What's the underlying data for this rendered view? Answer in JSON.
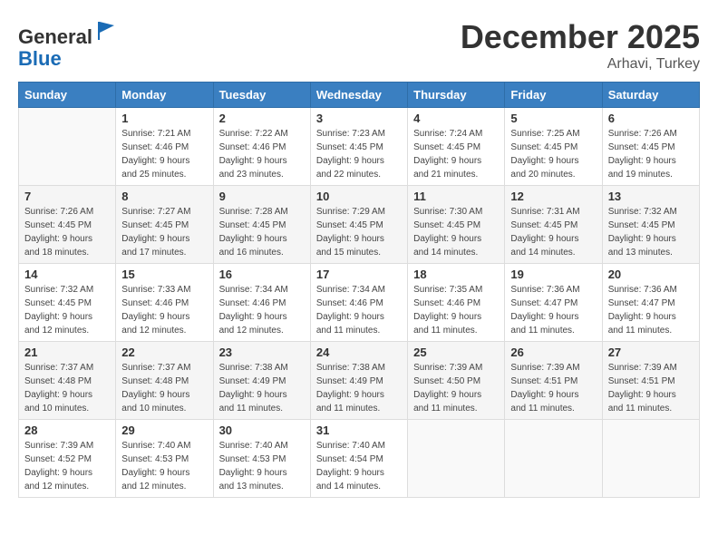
{
  "header": {
    "logo_line1": "General",
    "logo_line2": "Blue",
    "month": "December 2025",
    "location": "Arhavi, Turkey"
  },
  "weekdays": [
    "Sunday",
    "Monday",
    "Tuesday",
    "Wednesday",
    "Thursday",
    "Friday",
    "Saturday"
  ],
  "weeks": [
    [
      {
        "day": "",
        "sunrise": "",
        "sunset": "",
        "daylight": ""
      },
      {
        "day": "1",
        "sunrise": "Sunrise: 7:21 AM",
        "sunset": "Sunset: 4:46 PM",
        "daylight": "Daylight: 9 hours and 25 minutes."
      },
      {
        "day": "2",
        "sunrise": "Sunrise: 7:22 AM",
        "sunset": "Sunset: 4:46 PM",
        "daylight": "Daylight: 9 hours and 23 minutes."
      },
      {
        "day": "3",
        "sunrise": "Sunrise: 7:23 AM",
        "sunset": "Sunset: 4:45 PM",
        "daylight": "Daylight: 9 hours and 22 minutes."
      },
      {
        "day": "4",
        "sunrise": "Sunrise: 7:24 AM",
        "sunset": "Sunset: 4:45 PM",
        "daylight": "Daylight: 9 hours and 21 minutes."
      },
      {
        "day": "5",
        "sunrise": "Sunrise: 7:25 AM",
        "sunset": "Sunset: 4:45 PM",
        "daylight": "Daylight: 9 hours and 20 minutes."
      },
      {
        "day": "6",
        "sunrise": "Sunrise: 7:26 AM",
        "sunset": "Sunset: 4:45 PM",
        "daylight": "Daylight: 9 hours and 19 minutes."
      }
    ],
    [
      {
        "day": "7",
        "sunrise": "Sunrise: 7:26 AM",
        "sunset": "Sunset: 4:45 PM",
        "daylight": "Daylight: 9 hours and 18 minutes."
      },
      {
        "day": "8",
        "sunrise": "Sunrise: 7:27 AM",
        "sunset": "Sunset: 4:45 PM",
        "daylight": "Daylight: 9 hours and 17 minutes."
      },
      {
        "day": "9",
        "sunrise": "Sunrise: 7:28 AM",
        "sunset": "Sunset: 4:45 PM",
        "daylight": "Daylight: 9 hours and 16 minutes."
      },
      {
        "day": "10",
        "sunrise": "Sunrise: 7:29 AM",
        "sunset": "Sunset: 4:45 PM",
        "daylight": "Daylight: 9 hours and 15 minutes."
      },
      {
        "day": "11",
        "sunrise": "Sunrise: 7:30 AM",
        "sunset": "Sunset: 4:45 PM",
        "daylight": "Daylight: 9 hours and 14 minutes."
      },
      {
        "day": "12",
        "sunrise": "Sunrise: 7:31 AM",
        "sunset": "Sunset: 4:45 PM",
        "daylight": "Daylight: 9 hours and 14 minutes."
      },
      {
        "day": "13",
        "sunrise": "Sunrise: 7:32 AM",
        "sunset": "Sunset: 4:45 PM",
        "daylight": "Daylight: 9 hours and 13 minutes."
      }
    ],
    [
      {
        "day": "14",
        "sunrise": "Sunrise: 7:32 AM",
        "sunset": "Sunset: 4:45 PM",
        "daylight": "Daylight: 9 hours and 12 minutes."
      },
      {
        "day": "15",
        "sunrise": "Sunrise: 7:33 AM",
        "sunset": "Sunset: 4:46 PM",
        "daylight": "Daylight: 9 hours and 12 minutes."
      },
      {
        "day": "16",
        "sunrise": "Sunrise: 7:34 AM",
        "sunset": "Sunset: 4:46 PM",
        "daylight": "Daylight: 9 hours and 12 minutes."
      },
      {
        "day": "17",
        "sunrise": "Sunrise: 7:34 AM",
        "sunset": "Sunset: 4:46 PM",
        "daylight": "Daylight: 9 hours and 11 minutes."
      },
      {
        "day": "18",
        "sunrise": "Sunrise: 7:35 AM",
        "sunset": "Sunset: 4:46 PM",
        "daylight": "Daylight: 9 hours and 11 minutes."
      },
      {
        "day": "19",
        "sunrise": "Sunrise: 7:36 AM",
        "sunset": "Sunset: 4:47 PM",
        "daylight": "Daylight: 9 hours and 11 minutes."
      },
      {
        "day": "20",
        "sunrise": "Sunrise: 7:36 AM",
        "sunset": "Sunset: 4:47 PM",
        "daylight": "Daylight: 9 hours and 11 minutes."
      }
    ],
    [
      {
        "day": "21",
        "sunrise": "Sunrise: 7:37 AM",
        "sunset": "Sunset: 4:48 PM",
        "daylight": "Daylight: 9 hours and 10 minutes."
      },
      {
        "day": "22",
        "sunrise": "Sunrise: 7:37 AM",
        "sunset": "Sunset: 4:48 PM",
        "daylight": "Daylight: 9 hours and 10 minutes."
      },
      {
        "day": "23",
        "sunrise": "Sunrise: 7:38 AM",
        "sunset": "Sunset: 4:49 PM",
        "daylight": "Daylight: 9 hours and 11 minutes."
      },
      {
        "day": "24",
        "sunrise": "Sunrise: 7:38 AM",
        "sunset": "Sunset: 4:49 PM",
        "daylight": "Daylight: 9 hours and 11 minutes."
      },
      {
        "day": "25",
        "sunrise": "Sunrise: 7:39 AM",
        "sunset": "Sunset: 4:50 PM",
        "daylight": "Daylight: 9 hours and 11 minutes."
      },
      {
        "day": "26",
        "sunrise": "Sunrise: 7:39 AM",
        "sunset": "Sunset: 4:51 PM",
        "daylight": "Daylight: 9 hours and 11 minutes."
      },
      {
        "day": "27",
        "sunrise": "Sunrise: 7:39 AM",
        "sunset": "Sunset: 4:51 PM",
        "daylight": "Daylight: 9 hours and 11 minutes."
      }
    ],
    [
      {
        "day": "28",
        "sunrise": "Sunrise: 7:39 AM",
        "sunset": "Sunset: 4:52 PM",
        "daylight": "Daylight: 9 hours and 12 minutes."
      },
      {
        "day": "29",
        "sunrise": "Sunrise: 7:40 AM",
        "sunset": "Sunset: 4:53 PM",
        "daylight": "Daylight: 9 hours and 12 minutes."
      },
      {
        "day": "30",
        "sunrise": "Sunrise: 7:40 AM",
        "sunset": "Sunset: 4:53 PM",
        "daylight": "Daylight: 9 hours and 13 minutes."
      },
      {
        "day": "31",
        "sunrise": "Sunrise: 7:40 AM",
        "sunset": "Sunset: 4:54 PM",
        "daylight": "Daylight: 9 hours and 14 minutes."
      },
      {
        "day": "",
        "sunrise": "",
        "sunset": "",
        "daylight": ""
      },
      {
        "day": "",
        "sunrise": "",
        "sunset": "",
        "daylight": ""
      },
      {
        "day": "",
        "sunrise": "",
        "sunset": "",
        "daylight": ""
      }
    ]
  ]
}
